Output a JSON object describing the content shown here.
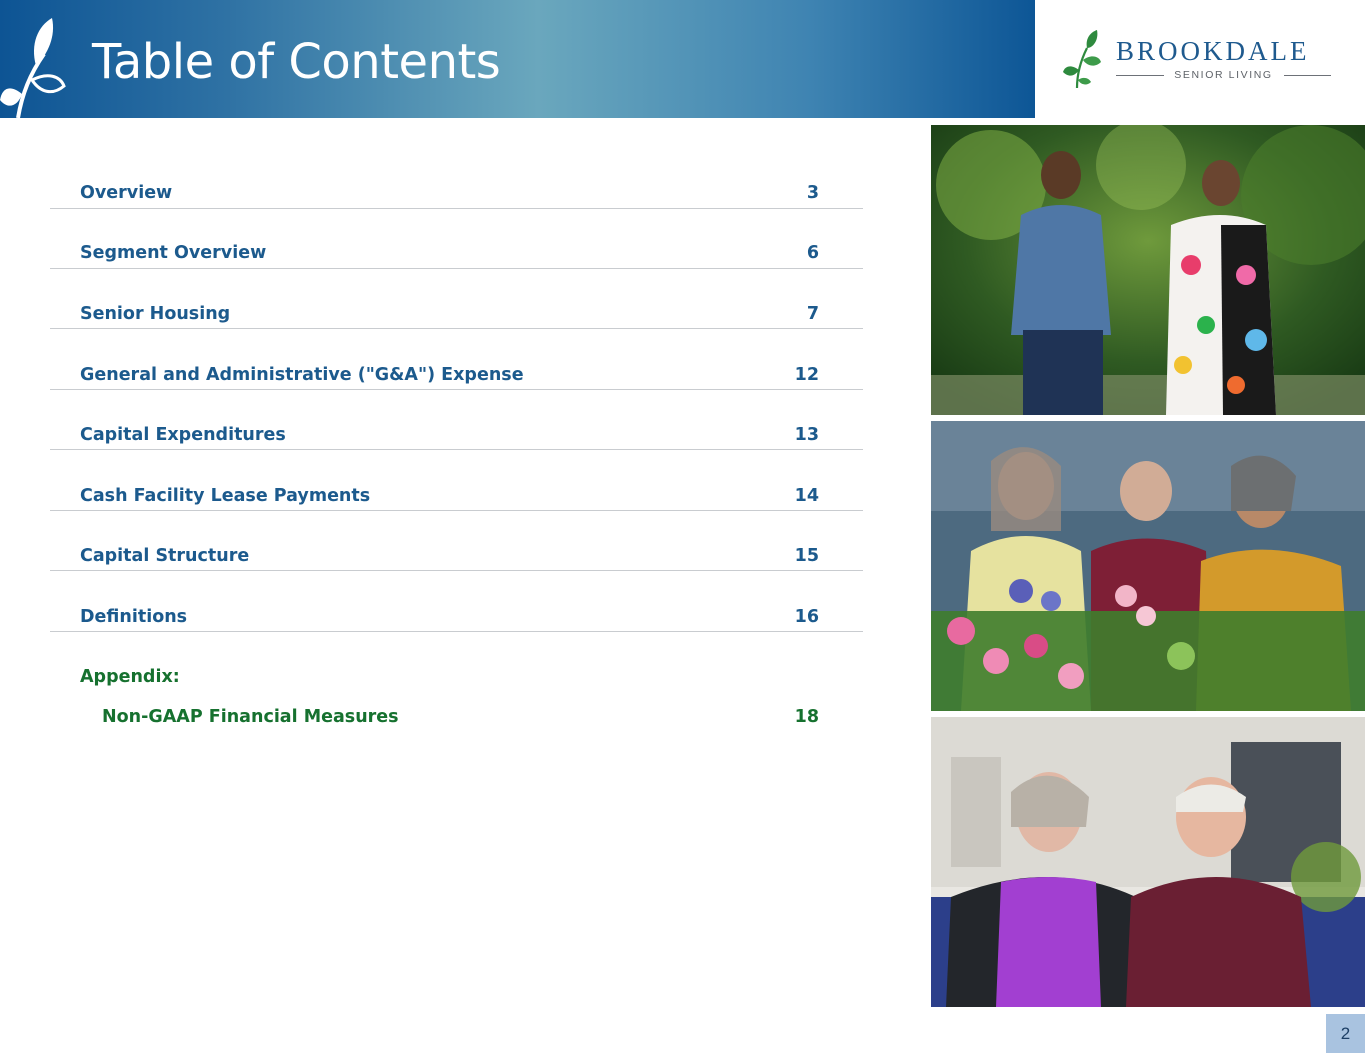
{
  "header": {
    "title": "Table of Contents",
    "gradient_colors": [
      "#0d5494",
      "#6aa7bd",
      "#0d5696"
    ],
    "decoration_icon": "leaf-sprig-icon"
  },
  "logo": {
    "wordmark": "BROOKDALE",
    "tagline": "SENIOR LIVING",
    "brand_color": "#1f5a8e",
    "leaf_color": "#2e8a3e"
  },
  "toc": {
    "entries": [
      {
        "label": "Overview",
        "page": "3"
      },
      {
        "label": "Segment Overview",
        "page": "6"
      },
      {
        "label": "Senior Housing",
        "page": "7"
      },
      {
        "label": "General and Administrative (\"G&A\") Expense",
        "page": "12"
      },
      {
        "label": "Capital Expenditures",
        "page": "13"
      },
      {
        "label": "Cash Facility Lease Payments",
        "page": "14"
      },
      {
        "label": "Capital Structure",
        "page": "15"
      },
      {
        "label": "Definitions",
        "page": "16"
      }
    ],
    "appendix": {
      "heading": "Appendix:",
      "items": [
        {
          "label": "Non-GAAP Financial Measures",
          "page": "18"
        }
      ]
    },
    "entry_color": "#1c5a8d",
    "appendix_color": "#16712f"
  },
  "photos": [
    {
      "name": "photo-couple-garden"
    },
    {
      "name": "photo-women-flowers"
    },
    {
      "name": "photo-couple-seated"
    }
  ],
  "footer": {
    "page_number": "2"
  }
}
